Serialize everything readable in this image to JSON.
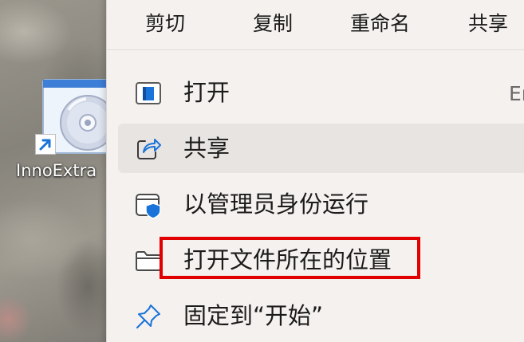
{
  "desktop": {
    "shortcut_label": "InnoExtra",
    "icon": "cd-disc-app-icon",
    "overlay_icon": "shortcut-arrow-icon"
  },
  "context_menu": {
    "top_actions": [
      {
        "label": "剪切"
      },
      {
        "label": "复制"
      },
      {
        "label": "重命名"
      },
      {
        "label": "共享"
      }
    ],
    "items": [
      {
        "label": "打开",
        "icon": "open-window-icon",
        "shortcut": "Er"
      },
      {
        "label": "共享",
        "icon": "share-icon",
        "hovered": true
      },
      {
        "label": "以管理员身份运行",
        "icon": "shield-admin-icon"
      },
      {
        "label": "打开文件所在的位置",
        "icon": "folder-icon",
        "highlighted": true
      },
      {
        "label": "固定到“开始”",
        "icon": "pin-icon"
      }
    ]
  },
  "colors": {
    "menu_background": "#f4f1ee",
    "hover_background": "#e7e4e1",
    "highlight_border": "#e00000",
    "accent_blue": "#1a73d9"
  }
}
